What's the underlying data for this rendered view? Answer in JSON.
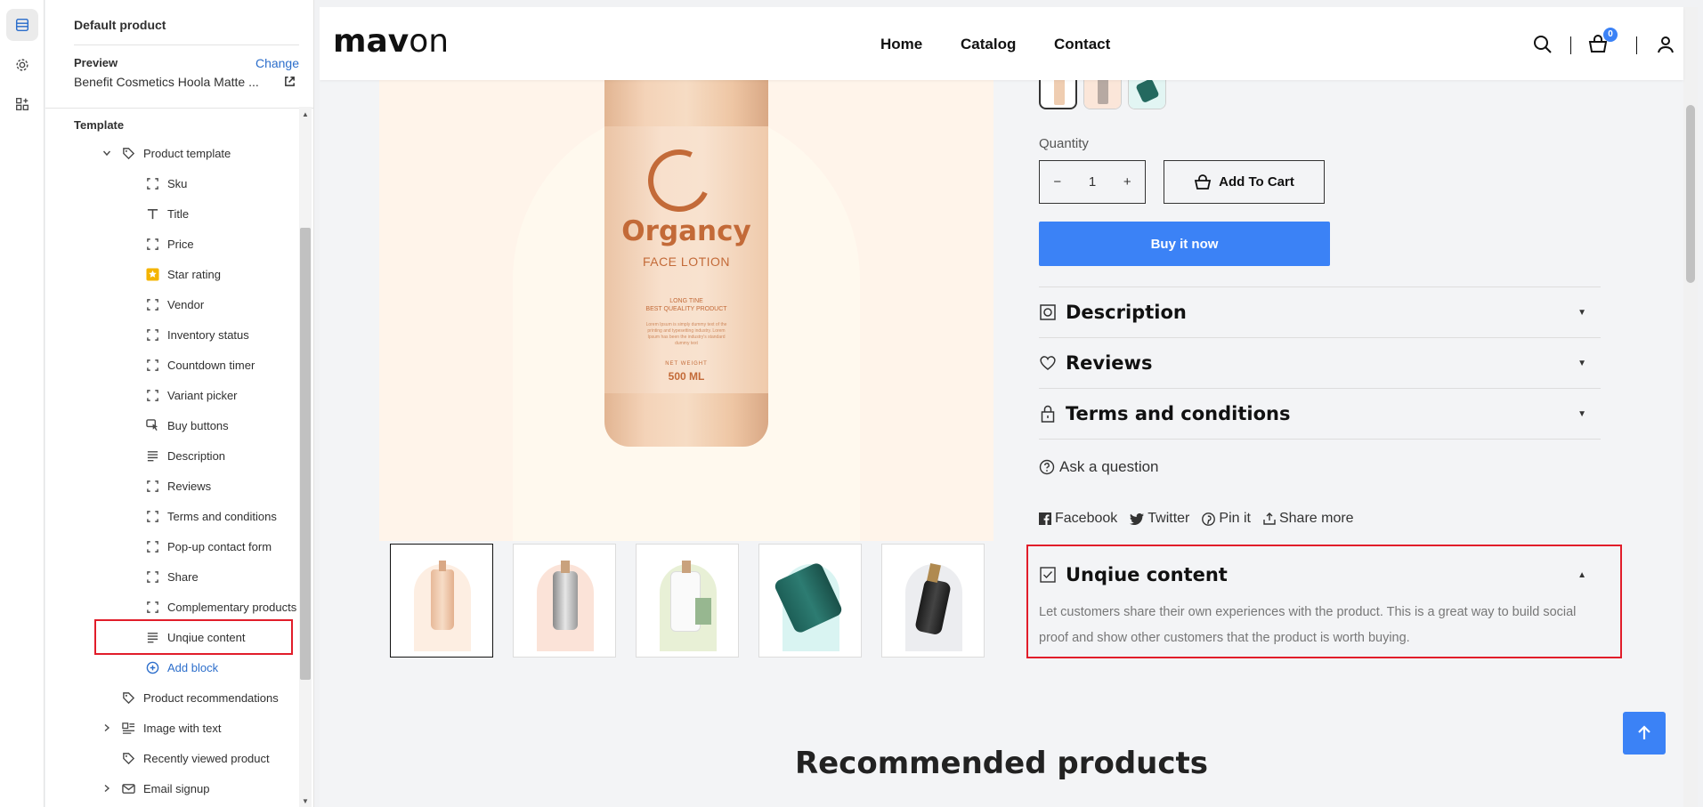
{
  "sidebar": {
    "title": "Default product",
    "preview_label": "Preview",
    "change_label": "Change",
    "preview_value": "Benefit Cosmetics Hoola Matte ...",
    "template_label": "Template",
    "product_template": "Product template",
    "blocks": [
      {
        "label": "Sku",
        "icon": "block-icon"
      },
      {
        "label": "Title",
        "icon": "text-icon"
      },
      {
        "label": "Price",
        "icon": "block-icon"
      },
      {
        "label": "Star rating",
        "icon": "star-icon"
      },
      {
        "label": "Vendor",
        "icon": "block-icon"
      },
      {
        "label": "Inventory status",
        "icon": "block-icon"
      },
      {
        "label": "Countdown timer",
        "icon": "block-icon"
      },
      {
        "label": "Variant picker",
        "icon": "block-icon"
      },
      {
        "label": "Buy buttons",
        "icon": "cursor-icon"
      },
      {
        "label": "Description",
        "icon": "lines-icon"
      },
      {
        "label": "Reviews",
        "icon": "block-icon"
      },
      {
        "label": "Terms and conditions",
        "icon": "block-icon"
      },
      {
        "label": "Pop-up contact form",
        "icon": "block-icon"
      },
      {
        "label": "Share",
        "icon": "block-icon"
      },
      {
        "label": "Complementary products",
        "icon": "block-icon"
      },
      {
        "label": "Unqiue content",
        "icon": "lines-icon"
      }
    ],
    "add_block": "Add block",
    "sections": [
      {
        "label": "Product recommendations",
        "icon": "tag-icon",
        "expandable": false
      },
      {
        "label": "Image with text",
        "icon": "image-text-icon",
        "expandable": true
      },
      {
        "label": "Recently viewed product",
        "icon": "tag-icon",
        "expandable": false
      },
      {
        "label": "Email signup",
        "icon": "mail-icon",
        "expandable": true
      }
    ]
  },
  "store": {
    "logo_bold": "mav",
    "logo_light": "on",
    "nav": [
      "Home",
      "Catalog",
      "Contact"
    ],
    "cart_count": "0"
  },
  "product_image": {
    "brand": "Organcy",
    "subtitle": "FACE LOTION",
    "tagline": "LONG TINE\nBEST QUEALITY PRODUCT",
    "body": "Lorem Ipsum is simply dummy text of the printing and typesetting industry. Lorem Ipsum has been the industry's standard dummy text",
    "net_weight_label": "NET WEIGHT",
    "net_weight": "500 ML"
  },
  "product": {
    "quantity_label": "Quantity",
    "quantity": "1",
    "qty_minus": "−",
    "qty_plus": "+",
    "add_to_cart": "Add To Cart",
    "buy_now": "Buy it now",
    "accordions": [
      {
        "title": "Description"
      },
      {
        "title": "Reviews"
      },
      {
        "title": "Terms and conditions"
      }
    ],
    "ask_question": "Ask a question",
    "share": {
      "facebook": "Facebook",
      "twitter": "Twitter",
      "pinterest": "Pin it",
      "more": "Share more"
    },
    "unique_content": {
      "title": "Unqiue content",
      "text": "Let customers share their own experiences with the product. This is a great way to build social proof and show other customers that the product is worth buying."
    }
  },
  "recommended_title": "Recommended products",
  "colors": {
    "accent": "#3b82f6",
    "highlight": "#e11d2a",
    "brand_label": "#c36a38"
  }
}
